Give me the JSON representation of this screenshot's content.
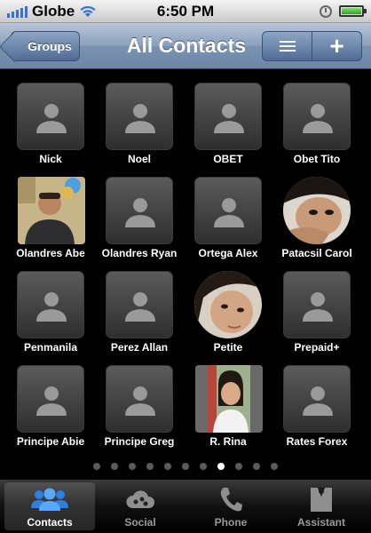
{
  "status_bar": {
    "carrier": "Globe",
    "time": "6:50 PM"
  },
  "nav_bar": {
    "back_label": "Groups",
    "title": "All Contacts"
  },
  "contacts": [
    {
      "name": "Nick",
      "avatar": "placeholder"
    },
    {
      "name": "Noel",
      "avatar": "placeholder"
    },
    {
      "name": "OBET",
      "avatar": "placeholder"
    },
    {
      "name": "Obet Tito",
      "avatar": "placeholder"
    },
    {
      "name": "Olandres Abe",
      "avatar": "photo"
    },
    {
      "name": "Olandres Ryan",
      "avatar": "placeholder"
    },
    {
      "name": "Ortega Alex",
      "avatar": "placeholder"
    },
    {
      "name": "Patacsil Carol",
      "avatar": "photo-circle"
    },
    {
      "name": "Penmanila",
      "avatar": "placeholder"
    },
    {
      "name": "Perez Allan",
      "avatar": "placeholder"
    },
    {
      "name": "Petite",
      "avatar": "photo-circle"
    },
    {
      "name": "Prepaid+",
      "avatar": "placeholder"
    },
    {
      "name": "Principe Abie",
      "avatar": "placeholder"
    },
    {
      "name": "Principe Greg",
      "avatar": "placeholder"
    },
    {
      "name": "R. Rina",
      "avatar": "photo"
    },
    {
      "name": "Rates Forex",
      "avatar": "placeholder"
    }
  ],
  "pagination": {
    "total": 11,
    "current": 8
  },
  "tabs": [
    {
      "label": "Contacts",
      "icon": "contacts-icon",
      "active": true
    },
    {
      "label": "Social",
      "icon": "social-icon",
      "active": false
    },
    {
      "label": "Phone",
      "icon": "phone-icon",
      "active": false
    },
    {
      "label": "Assistant",
      "icon": "assistant-icon",
      "active": false
    }
  ],
  "colors": {
    "signal": "#3770d6",
    "nav_bar": "#7b92b1",
    "battery": "#2da61e"
  }
}
